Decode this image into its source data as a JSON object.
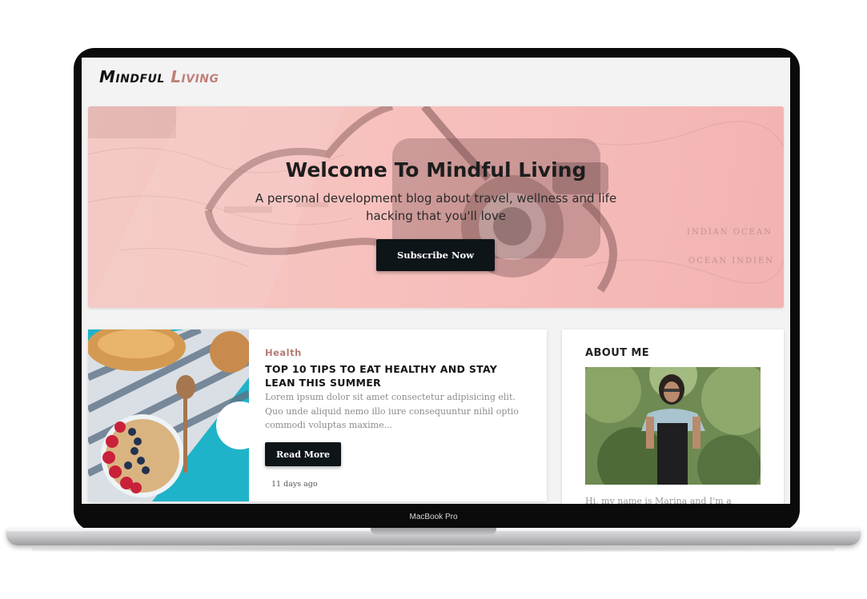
{
  "device": {
    "label": "MacBook Pro"
  },
  "site": {
    "logo_word1": "Mindful",
    "logo_word2": "Living"
  },
  "hero": {
    "title_prefix": "Welcome To ",
    "title_bold": "Mindful Living",
    "subtitle": "A personal development blog about travel, wellness and life hacking that you'll love",
    "button_label": "Subscribe Now",
    "map_text_1": "INDIAN OCEAN",
    "map_text_2": "OCEAN INDIEN",
    "colors": {
      "tint": "#f7c0bd",
      "button": "#0e1518"
    }
  },
  "post": {
    "category": "Health",
    "title": "TOP 10 TIPS TO EAT HEALTHY AND STAY LEAN THIS SUMMER",
    "excerpt": "Lorem ipsum dolor sit amet consectetur adipisicing elit. Quo unde aliquid nemo illo iure consequuntur nihil optio commodi voluptas maxime...",
    "button_label": "Read More",
    "date": "11 days ago",
    "colors": {
      "category": "#b47c74"
    }
  },
  "about": {
    "title": "ABOUT ME",
    "text": "Hi, my name is Marina and I'm a"
  }
}
